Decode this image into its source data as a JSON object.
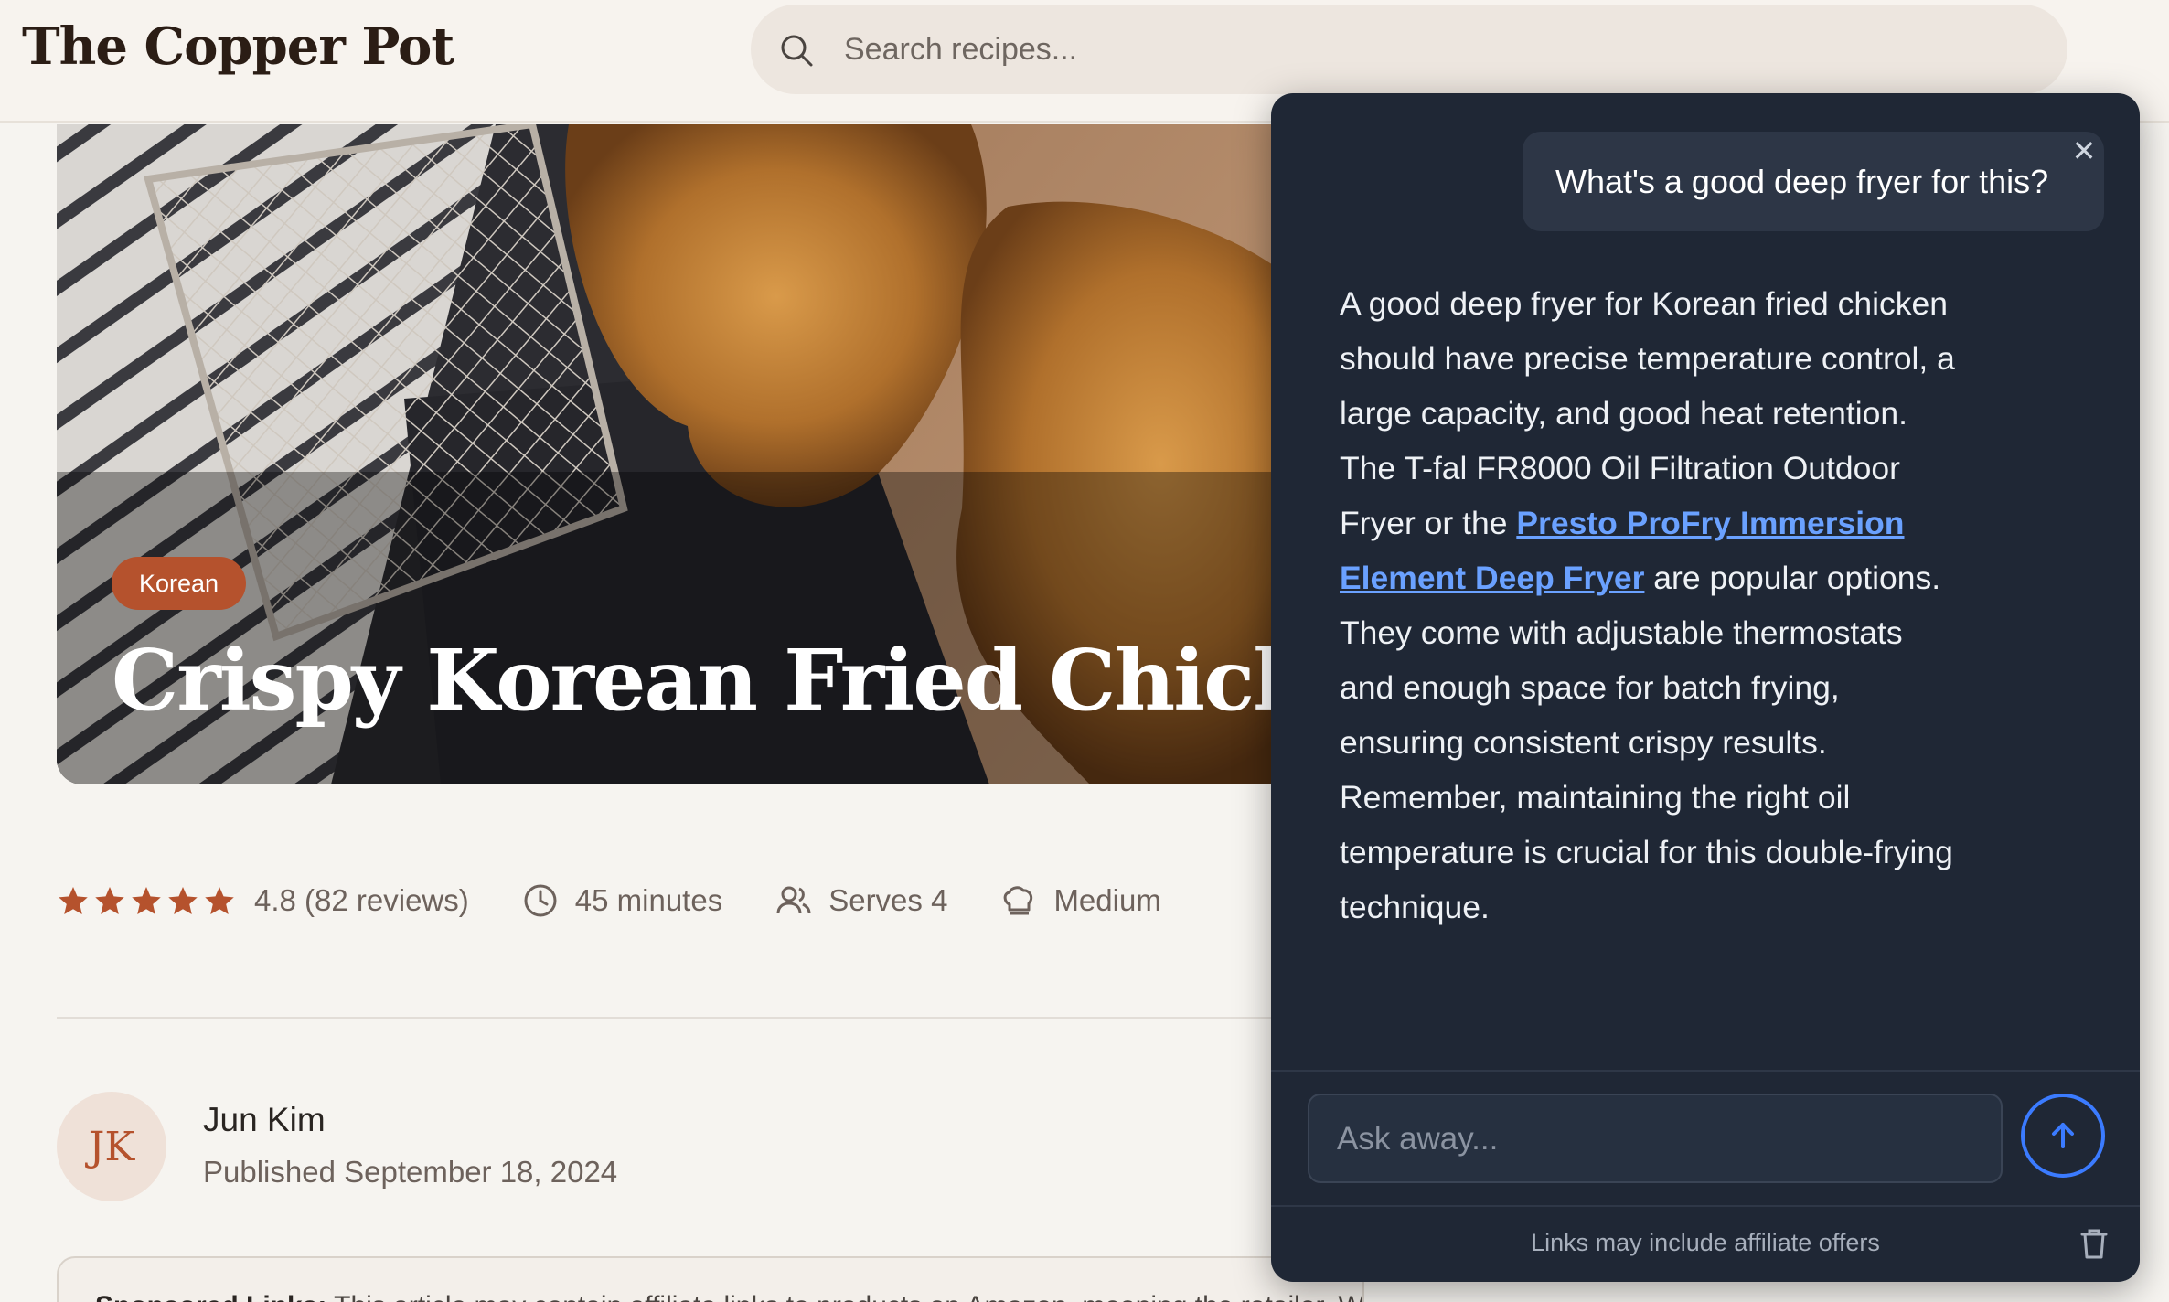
{
  "site": {
    "logo": "The Copper Pot",
    "search_placeholder": "Search recipes..."
  },
  "hero": {
    "tag": "Korean",
    "title": "Crispy Korean Fried Chicken"
  },
  "meta": {
    "rating": 4.8,
    "stars": 5,
    "rating_text": "4.8 (82 reviews)",
    "time": "45 minutes",
    "serves": "Serves 4",
    "difficulty": "Medium"
  },
  "author": {
    "initials": "JK",
    "name": "Jun Kim",
    "published": "Published September 18, 2024"
  },
  "disclosure": {
    "label": "Sponsored Links:",
    "text": "This article may contain affiliate links to products on Amazon, meaning the retailer. We may earn a small commission when you purchase through these links"
  },
  "chat": {
    "user_question": "What's a good deep fryer for this?",
    "close_glyph": "✕",
    "answer_before_link": "A good deep fryer for Korean fried chicken should have precise temperature control, a large capacity, and good heat retention. The T-fal FR8000 Oil Filtration Outdoor Fryer or the ",
    "answer_link": "Presto ProFry Immersion Element Deep Fryer",
    "answer_after_link": " are popular options. They come with adjustable thermostats and enough space for batch frying, ensuring consistent crispy results. Remember, maintaining the right oil temperature is crucial for this double-frying technique.",
    "input_placeholder": "Ask away...",
    "footer_note": "Links may include affiliate offers"
  },
  "colors": {
    "accent": "#b5522d",
    "chat_bg": "#1f2735",
    "link": "#6aa1ff",
    "send_ring": "#3b7bff"
  }
}
